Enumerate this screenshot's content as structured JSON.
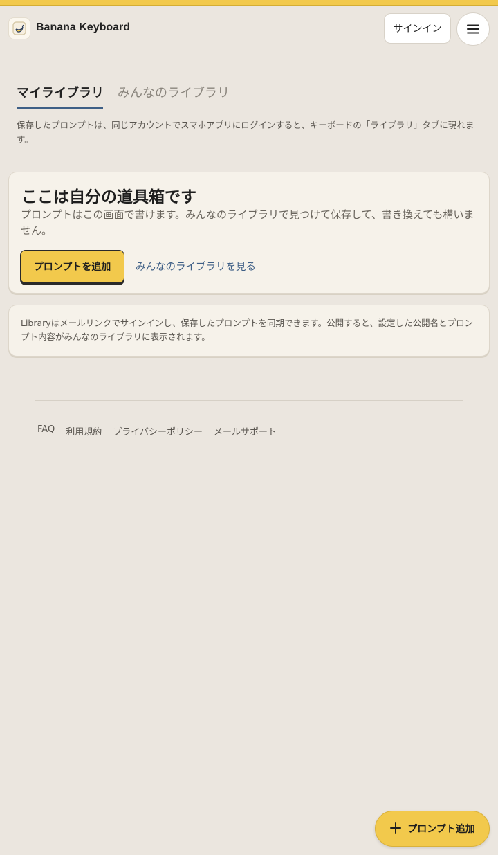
{
  "header": {
    "brand": "Banana Keyboard",
    "signin_label": "サインイン",
    "logo_icon": "banana-logo-icon",
    "menu_icon": "hamburger-menu-icon"
  },
  "tabs": [
    {
      "label": "マイライブラリ",
      "active": true
    },
    {
      "label": "みんなのライブラリ",
      "active": false
    }
  ],
  "notice": "保存したプロンプトは、同じアカウントでスマホアプリにログインすると、キーボードの「ライブラリ」タブに現れます。",
  "main_card": {
    "title": "ここは自分の道具箱です",
    "description": "プロンプトはこの画面で書けます。みんなのライブラリで見つけて保存して、書き換えても構いません。",
    "add_button": "プロンプトを追加",
    "view_link": "みんなのライブラリを見る"
  },
  "info_card": {
    "text": "Libraryはメールリンクでサインインし、保存したプロンプトを同期できます。公開すると、設定した公開名とプロンプト内容がみんなのライブラリに表示されます。"
  },
  "footer": {
    "links": [
      "FAQ",
      "利用規約",
      "プライバシーポリシー",
      "メールサポート"
    ]
  },
  "fab": {
    "label": "プロンプト追加",
    "icon": "plus-icon"
  },
  "colors": {
    "accent": "#f2c94c",
    "link": "#3e5f86",
    "background": "#ebe6df",
    "card": "#f6f2ea"
  }
}
